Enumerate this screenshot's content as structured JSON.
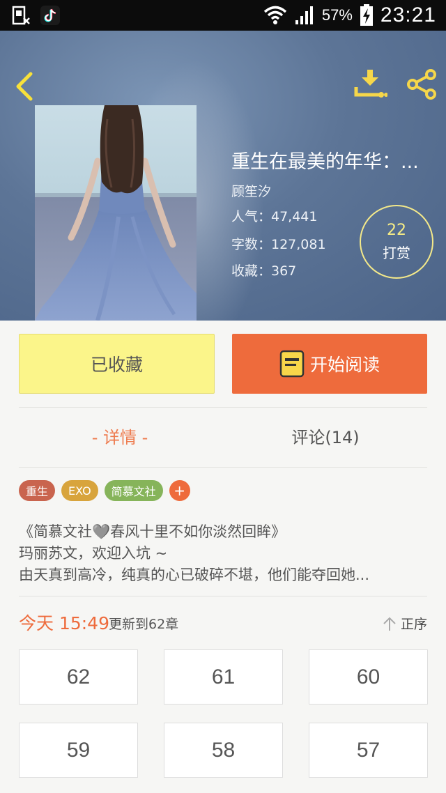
{
  "status_bar": {
    "battery": "57%",
    "time": "23:21"
  },
  "book": {
    "title": "重生在最美的年华：...",
    "author": "顾笙汐",
    "popularity": "人气：47,441",
    "word_count": "字数：127,081",
    "favorites": "收藏：367",
    "tip_count": "22",
    "tip_label": "打赏"
  },
  "actions": {
    "collected_label": "已收藏",
    "read_label": "开始阅读"
  },
  "tabs": {
    "detail": "- 详情 -",
    "comments": "评论(14)"
  },
  "tags": [
    {
      "label": "重生",
      "color": "#c9644e"
    },
    {
      "label": "EXO",
      "color": "#d8a43c"
    },
    {
      "label": "简慕文社",
      "color": "#86b45a"
    }
  ],
  "tag_add": "+",
  "intro": {
    "line1": "《简慕文社🩶春风十里不如你淡然回眸》",
    "line2": "玛丽苏文，欢迎入坑 ~",
    "line3": "由天真到高冷，纯真的心已破碎不堪，他们能夺回她..."
  },
  "update": {
    "time": "今天 15:49",
    "text": "更新到62章",
    "sort_label": "正序"
  },
  "chapters": [
    "62",
    "61",
    "60",
    "59",
    "58",
    "57"
  ],
  "colors": {
    "accent": "#ee6b3c",
    "collected_bg": "#fbf58a",
    "tip_ring": "#f4e98a"
  },
  "icons": {
    "back": "chevron-left-icon",
    "download": "download-icon",
    "share": "share-icon",
    "book": "book-icon",
    "sort": "arrow-up-icon"
  }
}
